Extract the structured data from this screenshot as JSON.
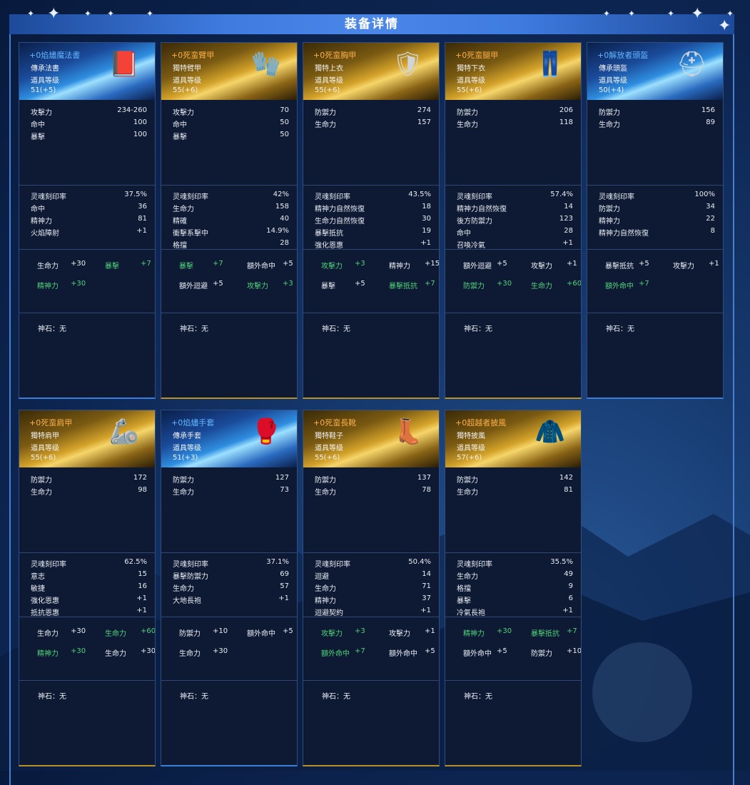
{
  "title": "装备详情",
  "cards": [
    {
      "theme": "blue",
      "icon": "book-icon",
      "glyph": "📕",
      "name": "+0焰燼魔法書",
      "type": "傳承法書",
      "level_label": "道具等级",
      "level": "51(+5)",
      "base": [
        {
          "k": "攻擊力",
          "v": "234-260"
        },
        {
          "k": "命中",
          "v": "100"
        },
        {
          "k": "暴擊",
          "v": "100"
        }
      ],
      "soul": [
        {
          "k": "灵魂刻印率",
          "v": "37.5%"
        },
        {
          "k": "命中",
          "v": "36"
        },
        {
          "k": "精神力",
          "v": "81"
        },
        {
          "k": "火焰障射",
          "v": "+1"
        }
      ],
      "bonus": [
        [
          {
            "k": "生命力",
            "v": "+30",
            "c": "w"
          },
          {
            "k": "暴擊",
            "v": "+7",
            "c": "g"
          }
        ],
        [
          {
            "k": "精神力",
            "v": "+30",
            "c": "g"
          }
        ]
      ],
      "stone": "神石：无"
    },
    {
      "theme": "gold",
      "icon": "gauntlet-icon",
      "glyph": "🧤",
      "name": "+0死蛮臂甲",
      "type": "獨特臂甲",
      "level_label": "道具等级",
      "level": "55(+6)",
      "base": [
        {
          "k": "攻擊力",
          "v": "70"
        },
        {
          "k": "命中",
          "v": "50"
        },
        {
          "k": "暴擊",
          "v": "50"
        }
      ],
      "soul": [
        {
          "k": "灵魂刻印率",
          "v": "42%"
        },
        {
          "k": "生命力",
          "v": "158"
        },
        {
          "k": "精確",
          "v": "40"
        },
        {
          "k": "衝擊系擊中",
          "v": "14.9%"
        },
        {
          "k": "格擋",
          "v": "28"
        }
      ],
      "bonus": [
        [
          {
            "k": "暴擊",
            "v": "+7",
            "c": "g"
          },
          {
            "k": "額外命中",
            "v": "+5",
            "c": "w"
          }
        ],
        [
          {
            "k": "額外迴避",
            "v": "+5",
            "c": "w"
          },
          {
            "k": "攻擊力",
            "v": "+3",
            "c": "g"
          }
        ]
      ],
      "stone": "神石：无"
    },
    {
      "theme": "gold",
      "icon": "chest-armor-icon",
      "glyph": "🛡",
      "name": "+0死蛮胸甲",
      "type": "獨特上衣",
      "level_label": "道具等级",
      "level": "55(+6)",
      "base": [
        {
          "k": "防禦力",
          "v": "274"
        },
        {
          "k": "生命力",
          "v": "157"
        }
      ],
      "soul": [
        {
          "k": "灵魂刻印率",
          "v": "43.5%"
        },
        {
          "k": "精神力自然恢復",
          "v": "18"
        },
        {
          "k": "生命力自然恢復",
          "v": "30"
        },
        {
          "k": "暴擊抵抗",
          "v": "19"
        },
        {
          "k": "強化恩惠",
          "v": "+1"
        }
      ],
      "bonus": [
        [
          {
            "k": "攻擊力",
            "v": "+3",
            "c": "g"
          },
          {
            "k": "精神力",
            "v": "+15",
            "c": "w"
          }
        ],
        [
          {
            "k": "暴擊",
            "v": "+5",
            "c": "w"
          },
          {
            "k": "暴擊抵抗",
            "v": "+7",
            "c": "g"
          }
        ]
      ],
      "stone": "神石：无"
    },
    {
      "theme": "gold",
      "icon": "leg-armor-icon",
      "glyph": "👖",
      "name": "+0死蛮腿甲",
      "type": "獨特下衣",
      "level_label": "道具等级",
      "level": "55(+6)",
      "base": [
        {
          "k": "防禦力",
          "v": "206"
        },
        {
          "k": "生命力",
          "v": "118"
        }
      ],
      "soul": [
        {
          "k": "灵魂刻印率",
          "v": "57.4%"
        },
        {
          "k": "精神力自然恢復",
          "v": "14"
        },
        {
          "k": "後方防禦力",
          "v": "123"
        },
        {
          "k": "命中",
          "v": "28"
        },
        {
          "k": "召喚冷氣",
          "v": "+1"
        }
      ],
      "bonus": [
        [
          {
            "k": "額外迴避",
            "v": "+5",
            "c": "w"
          },
          {
            "k": "攻擊力",
            "v": "+1",
            "c": "w"
          }
        ],
        [
          {
            "k": "防禦力",
            "v": "+30",
            "c": "g"
          },
          {
            "k": "生命力",
            "v": "+60",
            "c": "g"
          }
        ]
      ],
      "stone": "神石：无"
    },
    {
      "theme": "blue",
      "icon": "helmet-icon",
      "glyph": "⛑",
      "name": "+0解放者頭盔",
      "type": "傳承頭盔",
      "level_label": "道具等级",
      "level": "50(+4)",
      "base": [
        {
          "k": "防禦力",
          "v": "156"
        },
        {
          "k": "生命力",
          "v": "89"
        }
      ],
      "soul": [
        {
          "k": "灵魂刻印率",
          "v": "100%"
        },
        {
          "k": "防禦力",
          "v": "34"
        },
        {
          "k": "精神力",
          "v": "22"
        },
        {
          "k": "精神力自然恢復",
          "v": "8"
        }
      ],
      "bonus": [
        [
          {
            "k": "暴擊抵抗",
            "v": "+5",
            "c": "w"
          },
          {
            "k": "攻擊力",
            "v": "+1",
            "c": "w"
          }
        ],
        [
          {
            "k": "額外命中",
            "v": "+7",
            "c": "g"
          }
        ]
      ],
      "stone": "神石：无"
    },
    {
      "theme": "gold",
      "icon": "shoulder-armor-icon",
      "glyph": "🦾",
      "name": "+0死蛮肩甲",
      "type": "獨特肩甲",
      "level_label": "道具等级",
      "level": "55(+6)",
      "base": [
        {
          "k": "防禦力",
          "v": "172"
        },
        {
          "k": "生命力",
          "v": "98"
        }
      ],
      "soul": [
        {
          "k": "灵魂刻印率",
          "v": "62.5%"
        },
        {
          "k": "意志",
          "v": "15"
        },
        {
          "k": "敏捷",
          "v": "16"
        },
        {
          "k": "強化恩惠",
          "v": "+1"
        },
        {
          "k": "抵抗恩惠",
          "v": "+1"
        }
      ],
      "bonus": [
        [
          {
            "k": "生命力",
            "v": "+30",
            "c": "w"
          },
          {
            "k": "生命力",
            "v": "+60",
            "c": "g"
          }
        ],
        [
          {
            "k": "精神力",
            "v": "+30",
            "c": "g"
          },
          {
            "k": "生命力",
            "v": "+30",
            "c": "w"
          }
        ]
      ],
      "stone": "神石：无"
    },
    {
      "theme": "blue",
      "icon": "glove-icon",
      "glyph": "🥊",
      "name": "+0焰燼手套",
      "type": "傳承手套",
      "level_label": "道具等级",
      "level": "51(+3)",
      "base": [
        {
          "k": "防禦力",
          "v": "127"
        },
        {
          "k": "生命力",
          "v": "73"
        }
      ],
      "soul": [
        {
          "k": "灵魂刻印率",
          "v": "37.1%"
        },
        {
          "k": "暴擊防禦力",
          "v": "69"
        },
        {
          "k": "生命力",
          "v": "57"
        },
        {
          "k": "大地長袍",
          "v": "+1"
        }
      ],
      "bonus": [
        [
          {
            "k": "防禦力",
            "v": "+10",
            "c": "w"
          },
          {
            "k": "額外命中",
            "v": "+5",
            "c": "w"
          }
        ],
        [
          {
            "k": "生命力",
            "v": "+30",
            "c": "w"
          }
        ]
      ],
      "stone": "神石：无"
    },
    {
      "theme": "gold",
      "icon": "boots-icon",
      "glyph": "👢",
      "name": "+0死蛮長靴",
      "type": "獨特鞋子",
      "level_label": "道具等级",
      "level": "55(+6)",
      "base": [
        {
          "k": "防禦力",
          "v": "137"
        },
        {
          "k": "生命力",
          "v": "78"
        }
      ],
      "soul": [
        {
          "k": "灵魂刻印率",
          "v": "50.4%"
        },
        {
          "k": "迴避",
          "v": "14"
        },
        {
          "k": "生命力",
          "v": "71"
        },
        {
          "k": "精神力",
          "v": "37"
        },
        {
          "k": "迴避契約",
          "v": "+1"
        }
      ],
      "bonus": [
        [
          {
            "k": "攻擊力",
            "v": "+3",
            "c": "g"
          },
          {
            "k": "攻擊力",
            "v": "+1",
            "c": "w"
          }
        ],
        [
          {
            "k": "額外命中",
            "v": "+7",
            "c": "g"
          },
          {
            "k": "額外命中",
            "v": "+5",
            "c": "w"
          }
        ]
      ],
      "stone": "神石：无"
    },
    {
      "theme": "gold",
      "icon": "cloak-icon",
      "glyph": "🧥",
      "name": "+0超越者披風",
      "type": "獨特披風",
      "level_label": "道具等级",
      "level": "57(+6)",
      "base": [
        {
          "k": "防禦力",
          "v": "142"
        },
        {
          "k": "生命力",
          "v": "81"
        }
      ],
      "soul": [
        {
          "k": "灵魂刻印率",
          "v": "35.5%"
        },
        {
          "k": "生命力",
          "v": "49"
        },
        {
          "k": "格擋",
          "v": "9"
        },
        {
          "k": "暴擊",
          "v": "6"
        },
        {
          "k": "冷氣長袍",
          "v": "+1"
        }
      ],
      "bonus": [
        [
          {
            "k": "精神力",
            "v": "+30",
            "c": "g"
          },
          {
            "k": "暴擊抵抗",
            "v": "+7",
            "c": "g"
          }
        ],
        [
          {
            "k": "額外命中",
            "v": "+5",
            "c": "w"
          },
          {
            "k": "防禦力",
            "v": "+10",
            "c": "w"
          }
        ]
      ],
      "stone": "神石：无"
    }
  ]
}
